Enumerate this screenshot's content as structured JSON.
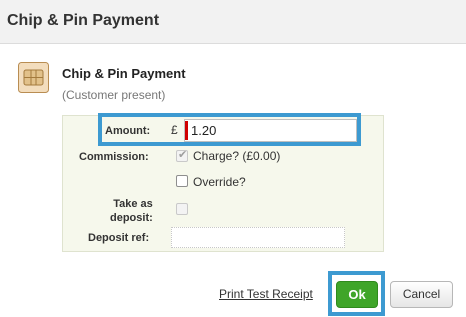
{
  "dialog": {
    "title": "Chip & Pin Payment"
  },
  "header": {
    "icon": "chip-card-icon",
    "title": "Chip & Pin Payment",
    "subtitle": "(Customer present)"
  },
  "form": {
    "amount": {
      "label": "Amount:",
      "currency": "£",
      "value": "1.20"
    },
    "commission": {
      "label": "Commission:",
      "charge_label": "Charge? (£0.00)",
      "charge_checked": true,
      "charge_disabled": true,
      "override_label": "Override?",
      "override_checked": false
    },
    "take_as_deposit": {
      "label_line1": "Take as",
      "label_line2": "deposit:",
      "checked": false,
      "disabled": true
    },
    "deposit_ref": {
      "label": "Deposit ref:",
      "value": ""
    }
  },
  "footer": {
    "print_link": "Print Test Receipt",
    "ok_label": "Ok",
    "cancel_label": "Cancel"
  },
  "colors": {
    "highlight": "#3d9ad1",
    "ok_button": "#3fa529",
    "panel_bg": "#f6f8ec",
    "caret": "#d00000"
  }
}
